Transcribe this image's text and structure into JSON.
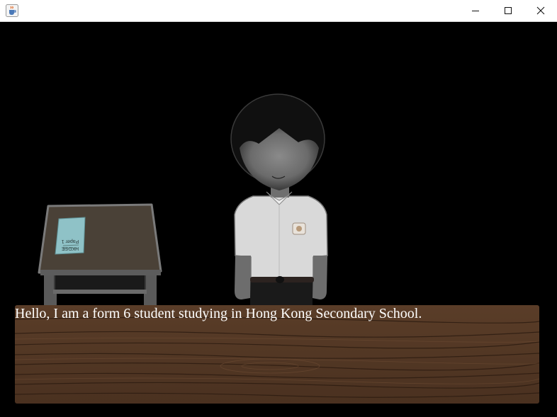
{
  "window": {
    "title": "",
    "icon": "java-cup-icon",
    "controls": [
      "minimize-icon",
      "maximize-icon",
      "close-icon"
    ]
  },
  "scene": {
    "background_color": "#000000",
    "character": "student-in-white-shirt",
    "prop": "school-desk-with-exam-paper",
    "paper_text": "HKDSE Paper 1"
  },
  "dialog": {
    "text": "Hello, I am a form 6 student studying in Hong Kong Secondary School.",
    "box_color": "#4b3322",
    "text_color": "#ffffff"
  }
}
